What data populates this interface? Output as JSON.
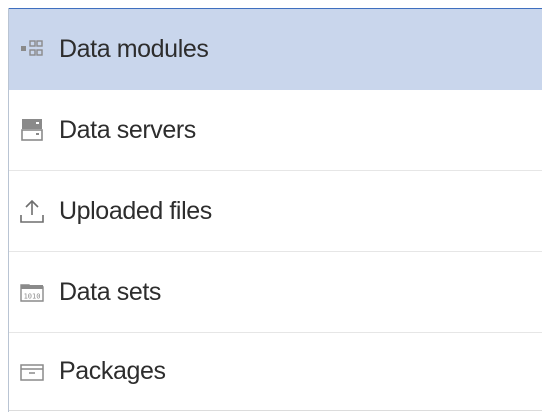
{
  "nav": {
    "items": [
      {
        "label": "Data modules",
        "icon": "data-modules-icon",
        "active": true
      },
      {
        "label": "Data servers",
        "icon": "data-servers-icon",
        "active": false
      },
      {
        "label": "Uploaded files",
        "icon": "upload-icon",
        "active": false
      },
      {
        "label": "Data sets",
        "icon": "data-sets-icon",
        "active": false
      },
      {
        "label": "Packages",
        "icon": "package-icon",
        "active": false
      }
    ]
  },
  "colors": {
    "active_bg": "#c9d6ec",
    "text": "#2d2d2d",
    "icon": "#8a8a8a",
    "accent_border": "#3f6fbf"
  }
}
